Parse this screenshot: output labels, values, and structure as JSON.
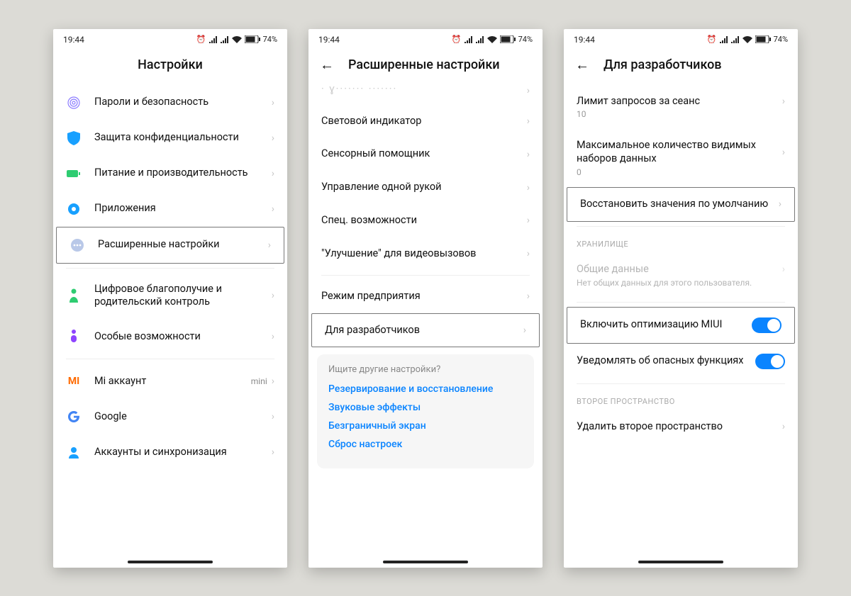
{
  "status": {
    "time": "19:44",
    "battery": "74%"
  },
  "screen1": {
    "title": "Настройки",
    "items": [
      {
        "label": "Пароли и безопасность"
      },
      {
        "label": "Защита конфиденциальности"
      },
      {
        "label": "Питание и производительность"
      },
      {
        "label": "Приложения"
      },
      {
        "label": "Расширенные настройки"
      },
      {
        "label": "Цифровое благополучие и родительский контроль"
      },
      {
        "label": "Особые возможности"
      },
      {
        "label": "Mi аккаунт",
        "trail": "mini"
      },
      {
        "label": "Google"
      },
      {
        "label": "Аккаунты и синхронизация"
      }
    ]
  },
  "screen2": {
    "title": "Расширенные настройки",
    "items": [
      {
        "label": "Световой индикатор"
      },
      {
        "label": "Сенсорный помощник"
      },
      {
        "label": "Управление одной рукой"
      },
      {
        "label": "Спец. возможности"
      },
      {
        "label": "\"Улучшение\" для видеовызовов"
      },
      {
        "label": "Режим предприятия"
      },
      {
        "label": "Для разработчиков"
      }
    ],
    "hint": {
      "title": "Ищите другие настройки?",
      "links": [
        "Резервирование и восстановление",
        "Звуковые эффекты",
        "Безграничный экран",
        "Сброс настроек"
      ]
    }
  },
  "screen3": {
    "title": "Для разработчиков",
    "items": {
      "limit": {
        "label": "Лимит запросов за сеанс",
        "value": "10"
      },
      "maxsets": {
        "label": "Максимальное количество видимых наборов данных",
        "value": "0"
      },
      "reset": {
        "label": "Восстановить значения по умолчанию"
      },
      "storageHeader": "ХРАНИЛИЩЕ",
      "shared": {
        "label": "Общие данные",
        "sub": "Нет общих данных для этого пользователя."
      },
      "miui": {
        "label": "Включить оптимизацию MIUI"
      },
      "danger": {
        "label": "Уведомлять об опасных функциях"
      },
      "spaceHeader": "ВТОРОЕ ПРОСТРАНСТВО",
      "delspace": {
        "label": "Удалить второе пространство"
      }
    }
  }
}
